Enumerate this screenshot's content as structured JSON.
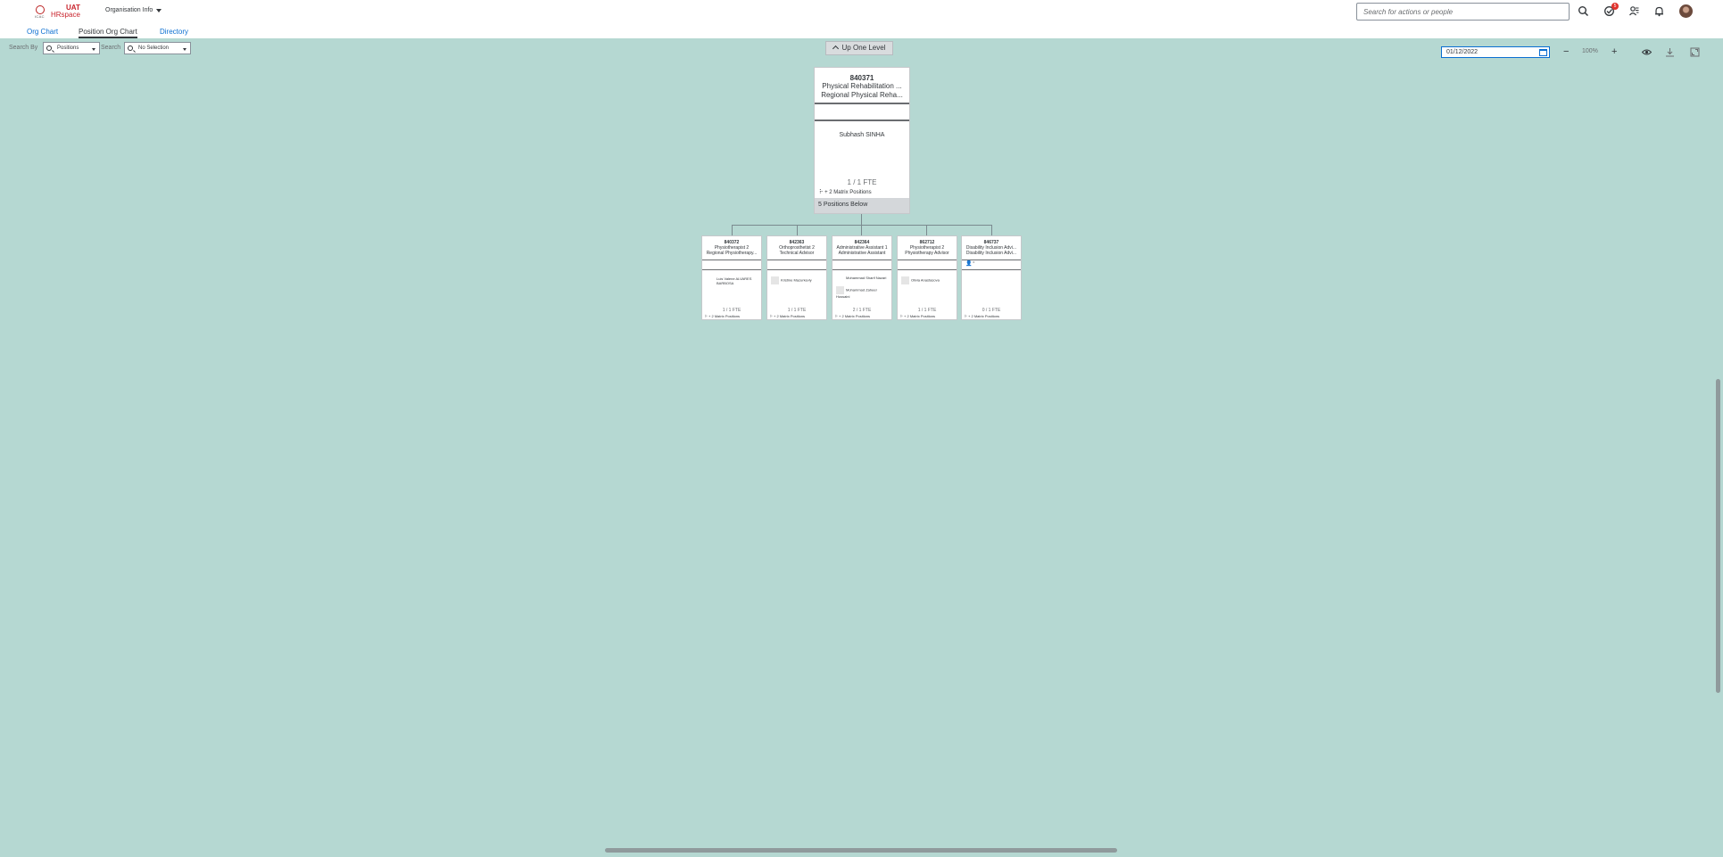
{
  "header": {
    "logo_crest_text": "ICAC",
    "logo_uat": "UAT",
    "logo_brand": "HRspace",
    "app_menu_label": "Organisation Info",
    "search_placeholder": "Search for actions or people",
    "notification_badge": "5",
    "icons": [
      "search-icon",
      "approvals-icon",
      "people-icon",
      "bell-icon",
      "avatar"
    ]
  },
  "tabs": [
    {
      "label": "Org Chart",
      "active": false
    },
    {
      "label": "Position Org Chart",
      "active": true
    },
    {
      "label": "Directory",
      "active": false
    }
  ],
  "toolbar": {
    "search_by_label": "Search By",
    "search_by_value": "Positions",
    "search_label": "Search",
    "search_value": "No Selection",
    "up_one_level": "Up One Level",
    "date": "01/12/2022",
    "zoom_out": "−",
    "zoom_level": "100%",
    "zoom_in": "+"
  },
  "main_position": {
    "id": "840371",
    "title": "Physical Rehabilitation ...",
    "subtitle": "Regional Physical Reha...",
    "holder": "Subhash SINHA",
    "fte": "1 / 1 FTE",
    "matrix": "+ 2 Matrix Positions",
    "below": "5 Positions Below"
  },
  "children": [
    {
      "id": "840372",
      "title": "Physiotherapist 2",
      "subtitle": "Regional Physiotherapy...",
      "holder": "Luis Valene ALVARES BARBOSA",
      "fte": "1 / 1 FTE",
      "matrix": "+ 2 Matrix Positions"
    },
    {
      "id": "842363",
      "title": "Orthoprosthetist 2",
      "subtitle": "Technical Advisor",
      "holder": "Kristine Mazurkeviy",
      "fte": "1 / 1 FTE",
      "matrix": "+ 2 Matrix Positions"
    },
    {
      "id": "842364",
      "title": "Administrative Assistant 1",
      "subtitle": "Administrative Assistant",
      "holder": "Mohammad Sharif Nazari",
      "holder2": "Mohammad Zaheer Hussaini",
      "fte": "2 / 1 FTE",
      "matrix": "+ 2 Matrix Positions"
    },
    {
      "id": "862712",
      "title": "Physiotherapist 2",
      "subtitle": "Physiotherapy Advisor",
      "holder": "Olivia Anastasova",
      "fte": "1 / 1 FTE",
      "matrix": "+ 2 Matrix Positions"
    },
    {
      "id": "846737",
      "title": "Disability Inclusion Advi...",
      "subtitle": "Disability Inclusion Advi...",
      "holder": "",
      "fte": "0 / 1 FTE",
      "matrix": "+ 2 Matrix Positions"
    }
  ]
}
